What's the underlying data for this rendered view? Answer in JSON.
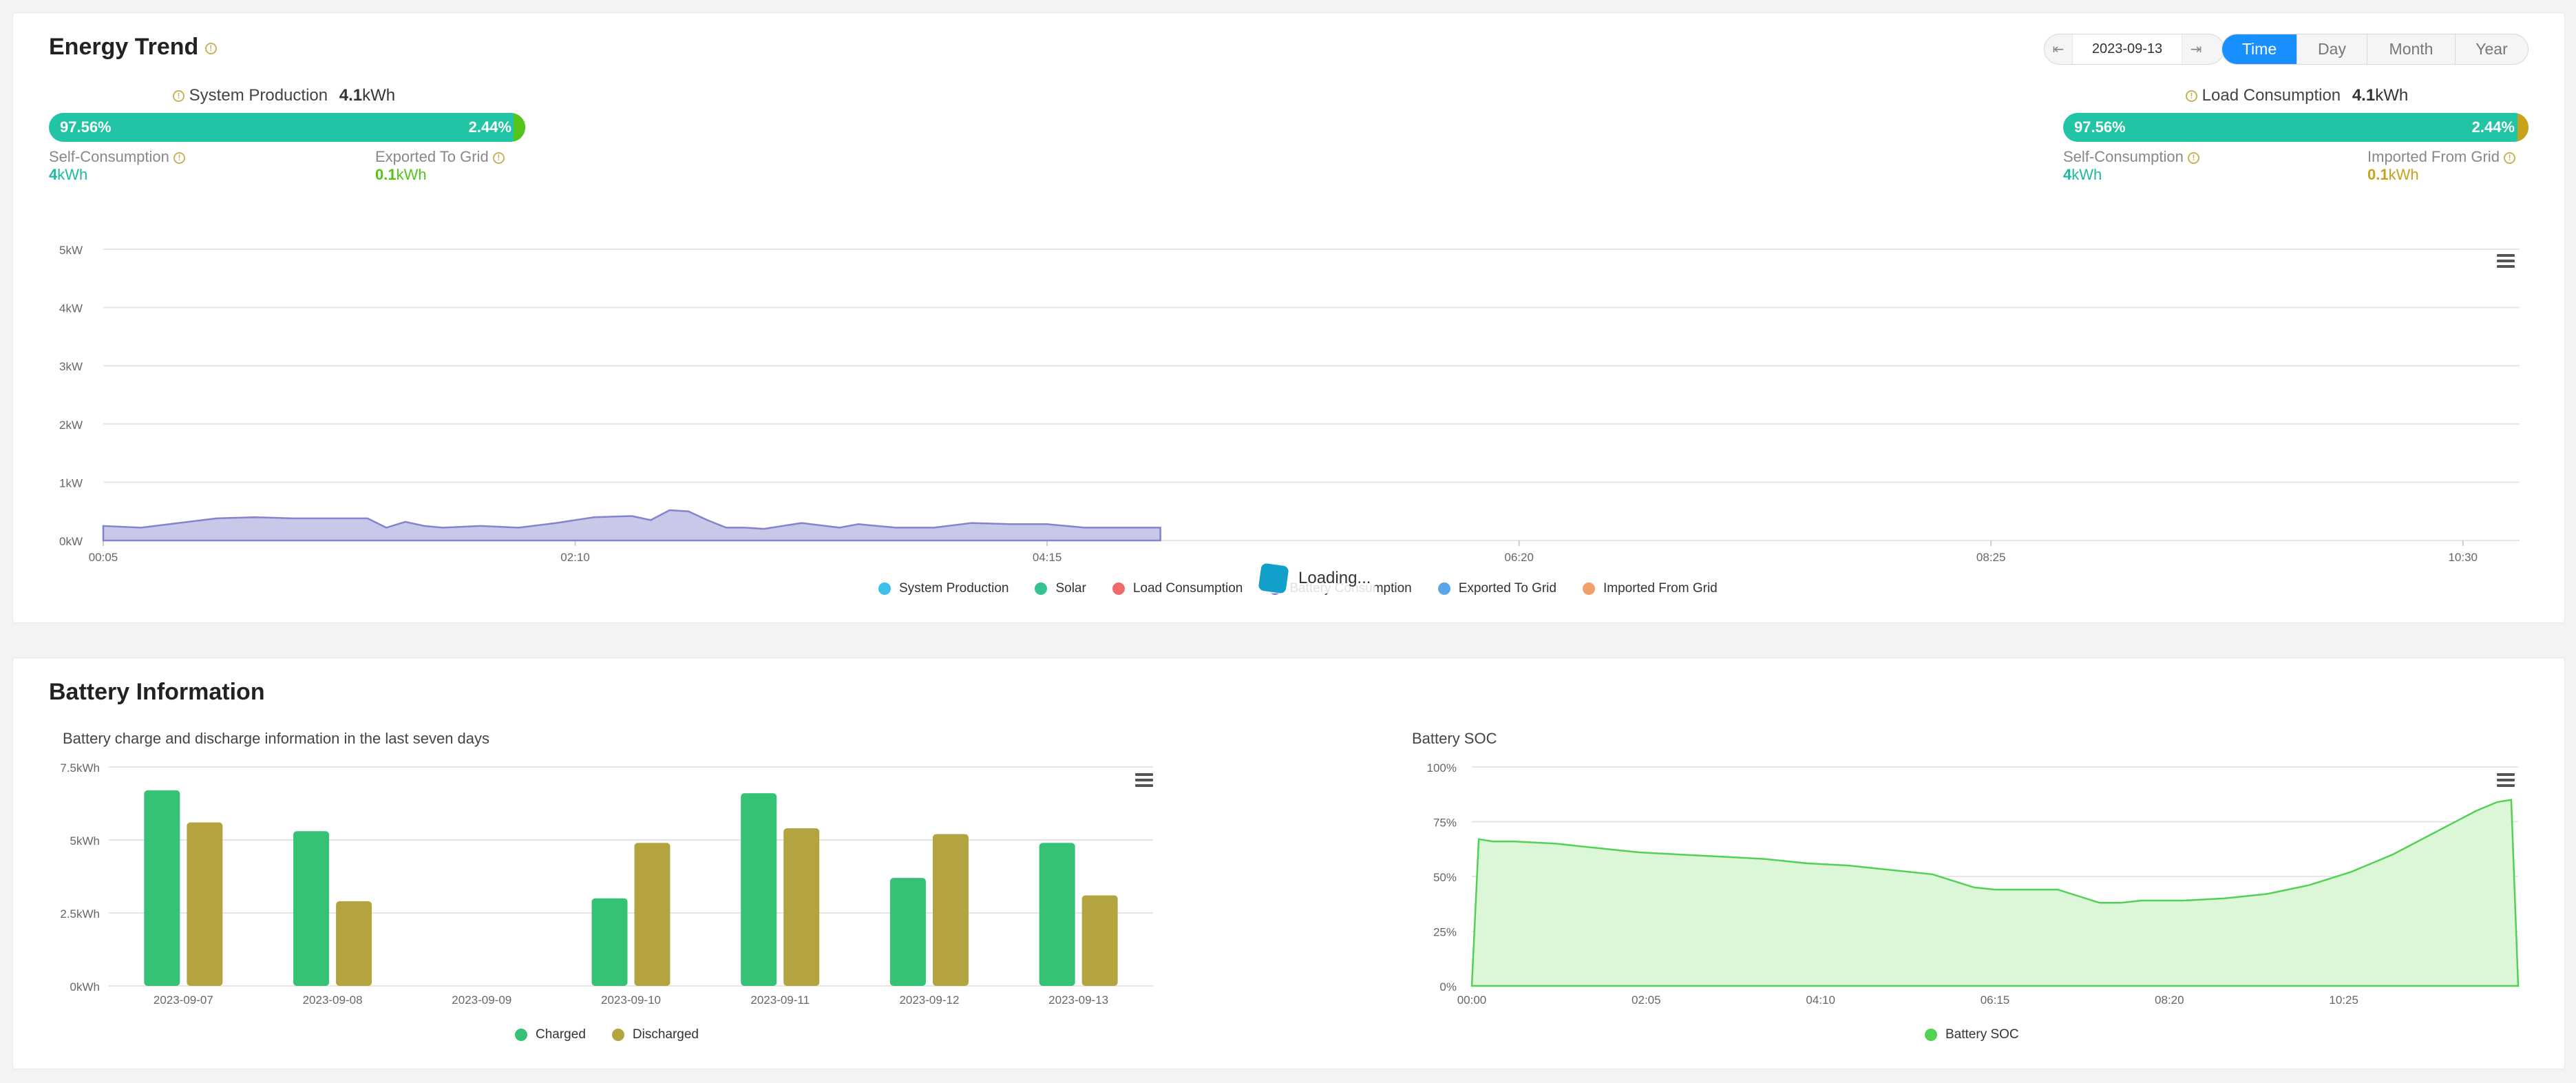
{
  "energy": {
    "title": "Energy Trend",
    "date": "2023-09-13",
    "prev_arrow": "⇤",
    "next_arrow": "⇥",
    "ranges": [
      "Time",
      "Day",
      "Month",
      "Year"
    ],
    "active_range": "Time",
    "production": {
      "label": "System Production",
      "value": "4.1",
      "unit": "kWh",
      "left_pct": "97.56%",
      "right_pct": "2.44%",
      "fill": 0.9756,
      "self_label": "Self-Consumption",
      "self_value": "4",
      "self_unit": "kWh",
      "grid_label": "Exported To Grid",
      "grid_value": "0.1",
      "grid_unit": "kWh",
      "tail_color": "#52c41a"
    },
    "consumption": {
      "label": "Load Consumption",
      "value": "4.1",
      "unit": "kWh",
      "left_pct": "97.56%",
      "right_pct": "2.44%",
      "fill": 0.9756,
      "self_label": "Self-Consumption",
      "self_value": "4",
      "self_unit": "kWh",
      "grid_label": "Imported From Grid",
      "grid_value": "0.1",
      "grid_unit": "kWh",
      "tail_color": "#c8a21a"
    },
    "loading_text": "Loading..."
  },
  "battery": {
    "title": "Battery Information",
    "bar_subtitle": "Battery charge and discharge information in the last seven days",
    "soc_subtitle": "Battery SOC"
  },
  "colors": {
    "teal": "#21c5a5",
    "self_value": "#21b8a0",
    "exported_value": "#52c41a",
    "imported_value": "#c8a21a",
    "charged": "#36c275",
    "discharged": "#b3a440",
    "soc_line": "#52d155",
    "production_area": "#8383cf"
  },
  "chart_data": [
    {
      "type": "area",
      "ylabel": "",
      "yticks": [
        "0kW",
        "1kW",
        "2kW",
        "3kW",
        "4kW",
        "5kW"
      ],
      "ylim": [
        0,
        5
      ],
      "xticks": [
        "00:05",
        "02:10",
        "04:15",
        "06:20",
        "08:25",
        "10:30"
      ],
      "x_minutes": [
        5,
        15,
        25,
        35,
        45,
        55,
        65,
        75,
        80,
        85,
        90,
        95,
        105,
        115,
        125,
        135,
        145,
        150,
        155,
        160,
        165,
        170,
        175,
        180,
        190,
        200,
        205,
        210,
        215,
        220,
        225,
        235,
        245,
        255,
        265,
        275,
        285
      ],
      "series": [
        {
          "name": "System Production",
          "color": "#8383cf",
          "values": [
            0.25,
            0.22,
            0.3,
            0.38,
            0.4,
            0.38,
            0.38,
            0.38,
            0.22,
            0.32,
            0.25,
            0.22,
            0.25,
            0.22,
            0.3,
            0.4,
            0.42,
            0.35,
            0.52,
            0.5,
            0.35,
            0.22,
            0.22,
            0.2,
            0.3,
            0.22,
            0.28,
            0.25,
            0.22,
            0.22,
            0.22,
            0.3,
            0.28,
            0.28,
            0.22,
            0.22,
            0.22
          ]
        }
      ],
      "legend": [
        {
          "name": "System Production",
          "color": "#3cbfe8"
        },
        {
          "name": "Solar",
          "color": "#36c290"
        },
        {
          "name": "Load Consumption",
          "color": "#f06a6a"
        },
        {
          "name": "Battery Consumption",
          "color": "#8a6ad6"
        },
        {
          "name": "Exported To Grid",
          "color": "#5aa5e8"
        },
        {
          "name": "Imported From Grid",
          "color": "#f2a06a"
        }
      ],
      "legend_position": "bottom"
    },
    {
      "type": "bar",
      "yticks": [
        "0kWh",
        "2.5kWh",
        "5kWh",
        "7.5kWh"
      ],
      "ylim": [
        0,
        7.5
      ],
      "categories": [
        "2023-09-07",
        "2023-09-08",
        "2023-09-09",
        "2023-09-10",
        "2023-09-11",
        "2023-09-12",
        "2023-09-13"
      ],
      "series": [
        {
          "name": "Charged",
          "color": "#36c275",
          "values": [
            6.7,
            5.3,
            0,
            3.0,
            6.6,
            3.7,
            4.9
          ]
        },
        {
          "name": "Discharged",
          "color": "#b3a440",
          "values": [
            5.6,
            2.9,
            0,
            4.9,
            5.4,
            5.2,
            3.1
          ]
        }
      ],
      "legend_position": "bottom"
    },
    {
      "type": "area",
      "yticks": [
        "0%",
        "25%",
        "50%",
        "75%",
        "100%"
      ],
      "ylim": [
        0,
        100
      ],
      "xticks": [
        "00:00",
        "02:05",
        "04:10",
        "06:15",
        "08:20",
        "10:25"
      ],
      "x_minutes": [
        0,
        5,
        15,
        30,
        60,
        90,
        120,
        150,
        180,
        210,
        240,
        270,
        300,
        330,
        360,
        375,
        390,
        420,
        450,
        465,
        480,
        510,
        540,
        570,
        600,
        630,
        660,
        690,
        720,
        735,
        745,
        750
      ],
      "series": [
        {
          "name": "Battery SOC",
          "color": "#52d155",
          "values": [
            0,
            67,
            66,
            66,
            65,
            63,
            61,
            60,
            59,
            58,
            56,
            55,
            53,
            51,
            45,
            44,
            44,
            44,
            38,
            38,
            39,
            39,
            40,
            42,
            46,
            52,
            60,
            70,
            80,
            84,
            85,
            0
          ]
        }
      ],
      "legend_position": "bottom"
    }
  ]
}
